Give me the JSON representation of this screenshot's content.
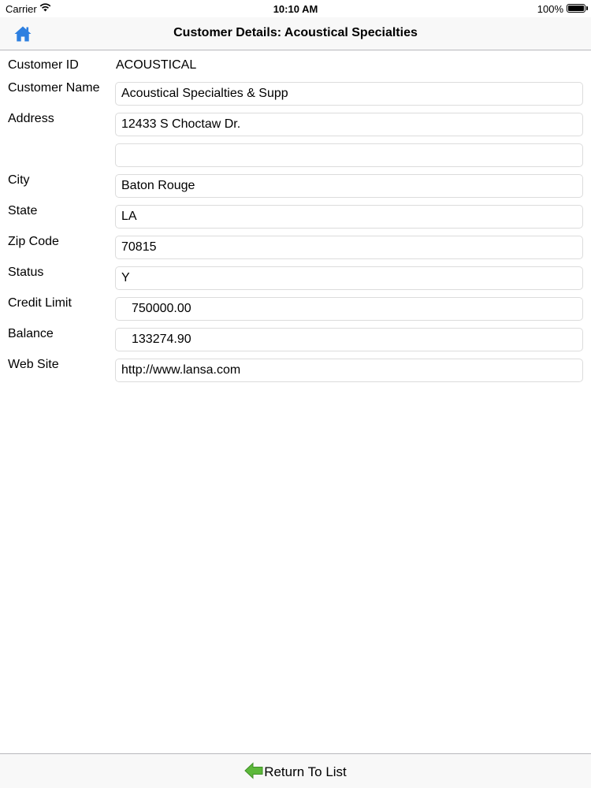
{
  "status_bar": {
    "carrier": "Carrier",
    "time": "10:10 AM",
    "battery": "100%"
  },
  "nav": {
    "title": "Customer Details: Acoustical Specialties",
    "home_icon": "home-icon"
  },
  "form": {
    "customer_id": {
      "label": "Customer ID",
      "value": "ACOUSTICAL"
    },
    "customer_name": {
      "label": "Customer Name",
      "value": "Acoustical Specialties & Supp"
    },
    "address": {
      "label": "Address",
      "value": "12433 S Choctaw Dr."
    },
    "address2": {
      "label": "",
      "value": ""
    },
    "city": {
      "label": "City",
      "value": "Baton Rouge"
    },
    "state": {
      "label": "State",
      "value": "LA"
    },
    "zip": {
      "label": "Zip Code",
      "value": "70815"
    },
    "status": {
      "label": "Status",
      "value": "Y"
    },
    "credit_limit": {
      "label": "Credit Limit",
      "value": "750000.00"
    },
    "balance": {
      "label": "Balance",
      "value": "133274.90"
    },
    "web_site": {
      "label": "Web Site",
      "value": "http://www.lansa.com"
    }
  },
  "toolbar": {
    "return_label": "Return To List",
    "return_icon": "left-arrow-icon"
  },
  "colors": {
    "accent": "#2d7fe0",
    "arrow_green": "#5cb83a",
    "bar_background": "#f8f8f8",
    "field_border": "#dcdcdc"
  }
}
